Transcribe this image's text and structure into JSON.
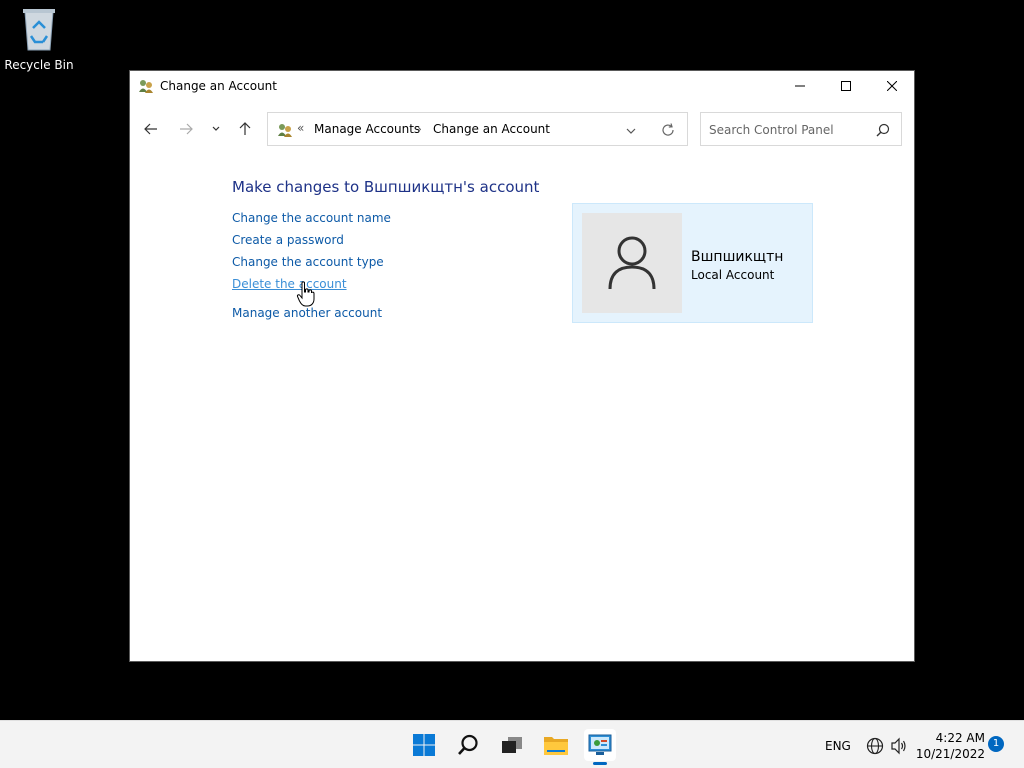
{
  "desktop": {
    "recycle_bin_label": "Recycle Bin"
  },
  "window": {
    "title": "Change an Account",
    "icon": "user-accounts-icon"
  },
  "address_bar": {
    "separator": "«",
    "crumbs": [
      "Manage Accounts",
      "Change an Account"
    ],
    "chevron": "›"
  },
  "search": {
    "placeholder": "Search Control Panel"
  },
  "main": {
    "heading": "Make changes to Вшпшикщтн's account",
    "links": {
      "change_name": "Change the account name",
      "create_password": "Create a password",
      "change_type": "Change the account type",
      "delete_account": "Delete the account",
      "manage_another": "Manage another account"
    }
  },
  "account_card": {
    "name": "Вшпшикщтн",
    "type": "Local Account"
  },
  "taskbar": {
    "language": "ENG",
    "time": "4:22 AM",
    "date": "10/21/2022",
    "notification_count": "1"
  },
  "colors": {
    "link": "#0d5aa7",
    "link_hover": "#3a8ed6",
    "heading": "#1e3287",
    "card_bg": "#e5f3fd",
    "accent": "#0067c0"
  }
}
